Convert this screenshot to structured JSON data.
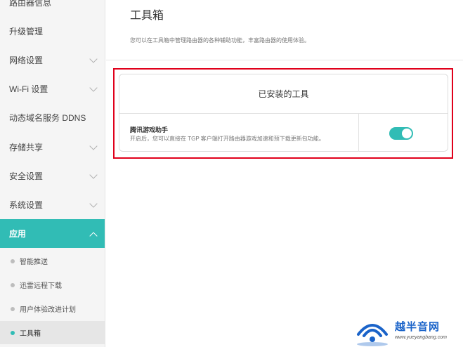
{
  "sidebar": {
    "items": [
      {
        "label": "路由器信息",
        "has_chevron": false
      },
      {
        "label": "升级管理",
        "has_chevron": false
      },
      {
        "label": "网络设置",
        "has_chevron": true
      },
      {
        "label": "Wi-Fi 设置",
        "has_chevron": true
      },
      {
        "label": "动态域名服务 DDNS",
        "has_chevron": false
      },
      {
        "label": "存储共享",
        "has_chevron": true
      },
      {
        "label": "安全设置",
        "has_chevron": true
      },
      {
        "label": "系统设置",
        "has_chevron": true
      },
      {
        "label": "应用",
        "has_chevron": true,
        "expanded": true
      }
    ],
    "sub_items": [
      {
        "label": "智能推送"
      },
      {
        "label": "迅雷远程下载"
      },
      {
        "label": "用户体验改进计划"
      },
      {
        "label": "工具箱",
        "selected": true
      }
    ]
  },
  "main": {
    "title": "工具箱",
    "description": "您可以在工具箱中管理路由器的各种辅助功能，丰富路由器的使用体验。",
    "installed_section": {
      "header": "已安装的工具",
      "tools": [
        {
          "name": "腾讯游戏助手",
          "description": "开启后，您可以直接在 TGP 客户端打开路由器游戏加速和预下载更新包功能。",
          "enabled": true
        }
      ]
    }
  },
  "watermark": {
    "text": "越半音网",
    "url": "www.yueyangbang.com"
  },
  "colors": {
    "accent": "#31bcb5",
    "highlight_border": "#e0001b",
    "watermark_blue": "#1a63c9"
  }
}
